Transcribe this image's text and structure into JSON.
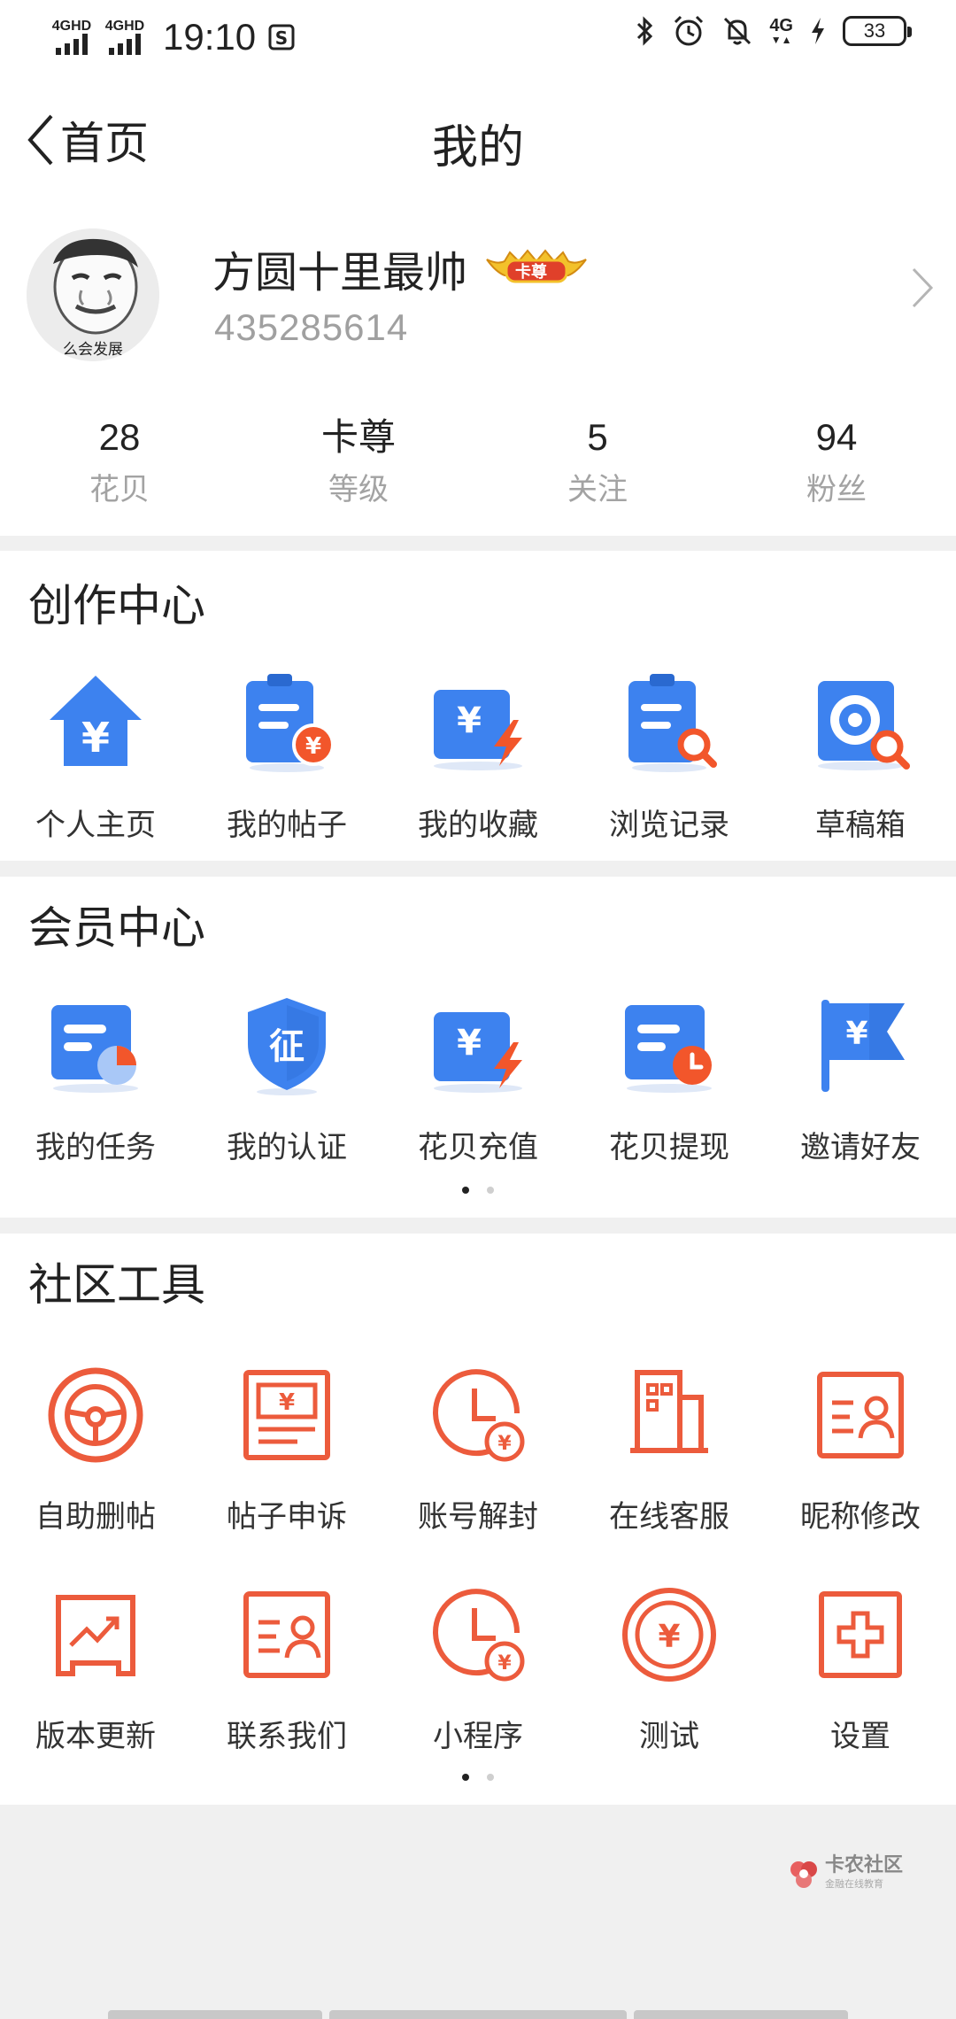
{
  "status_bar": {
    "network_1": "4GHD",
    "network_2": "4GHD",
    "time": "19:10",
    "cell_4g": "4G",
    "battery": "33"
  },
  "header": {
    "back_label": "首页",
    "title": "我的"
  },
  "profile": {
    "nickname": "方圆十里最帅",
    "badge": "卡尊",
    "uid": "435285614",
    "avatar_caption": "么会发展",
    "stats": [
      {
        "value": "28",
        "label": "花贝"
      },
      {
        "value": "卡尊",
        "label": "等级"
      },
      {
        "value": "5",
        "label": "关注"
      },
      {
        "value": "94",
        "label": "粉丝"
      }
    ]
  },
  "creation": {
    "title": "创作中心",
    "items": [
      {
        "label": "个人主页",
        "icon": "home-yuan-icon"
      },
      {
        "label": "我的帖子",
        "icon": "post-clipboard-icon"
      },
      {
        "label": "我的收藏",
        "icon": "collection-lightning-icon"
      },
      {
        "label": "浏览记录",
        "icon": "history-search-icon"
      },
      {
        "label": "草稿箱",
        "icon": "drafts-target-icon"
      }
    ]
  },
  "member": {
    "title": "会员中心",
    "items": [
      {
        "label": "我的任务",
        "icon": "task-chart-icon"
      },
      {
        "label": "我的认证",
        "icon": "verify-shield-icon",
        "glyph": "征"
      },
      {
        "label": "花贝充值",
        "icon": "recharge-lightning-icon"
      },
      {
        "label": "花贝提现",
        "icon": "withdraw-clock-icon"
      },
      {
        "label": "邀请好友",
        "icon": "invite-flag-icon"
      }
    ]
  },
  "tools": {
    "title": "社区工具",
    "row1": [
      {
        "label": "自助删帖",
        "icon": "steering-wheel-icon"
      },
      {
        "label": "帖子申诉",
        "icon": "appeal-bill-icon"
      },
      {
        "label": "账号解封",
        "icon": "clock-yuan-icon"
      },
      {
        "label": "在线客服",
        "icon": "service-building-icon"
      },
      {
        "label": "昵称修改",
        "icon": "id-card-icon"
      }
    ],
    "row2": [
      {
        "label": "版本更新",
        "icon": "trend-chart-icon"
      },
      {
        "label": "联系我们",
        "icon": "contact-card-icon"
      },
      {
        "label": "小程序",
        "icon": "mini-program-clock-icon"
      },
      {
        "label": "测试",
        "icon": "yuan-coin-icon"
      },
      {
        "label": "设置",
        "icon": "plus-box-icon"
      }
    ]
  },
  "watermark": {
    "title": "卡农社区",
    "subtitle": "金融在线教育"
  },
  "colors": {
    "blue": "#3d82ef",
    "orange": "#f2562b",
    "tool_red": "#ec5b3c"
  }
}
